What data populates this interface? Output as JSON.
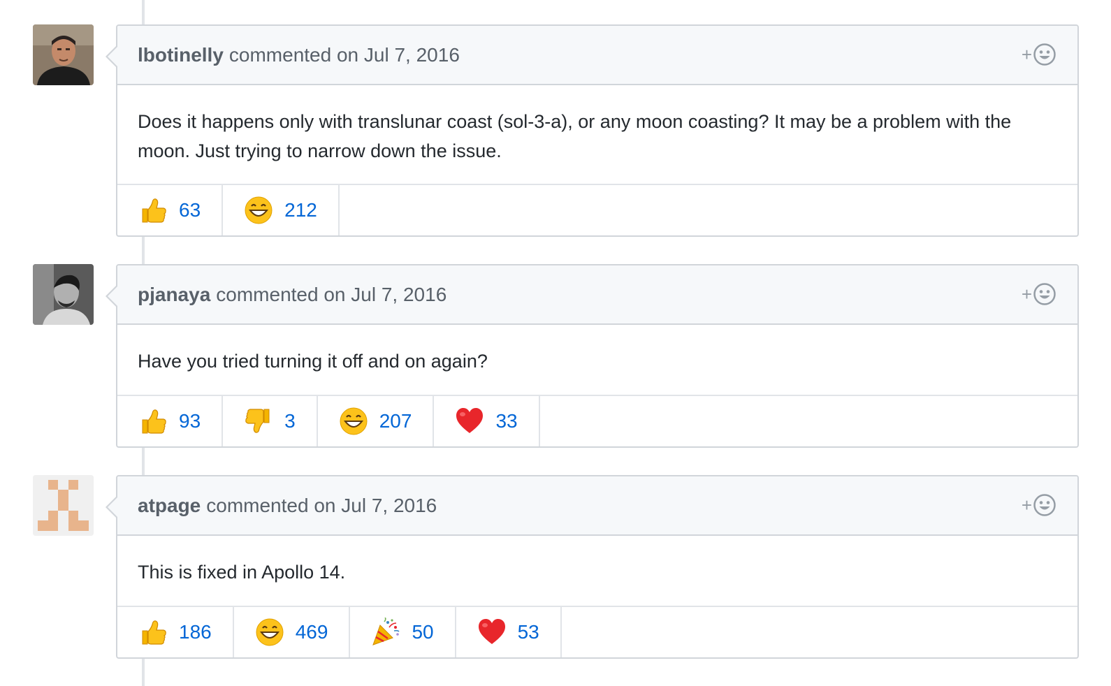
{
  "comments": [
    {
      "author": "lbotinelly",
      "action": "commented on Jul 7, 2016",
      "avatar": "portrait-photo-man",
      "body": "Does it happens only with translunar coast (sol-3-a), or any moon coasting? It may be a problem with the moon. Just trying to narrow down the issue.",
      "reactions": [
        {
          "emoji": "thumbs-up-icon",
          "count": "63"
        },
        {
          "emoji": "smile-icon",
          "count": "212"
        }
      ]
    },
    {
      "author": "pjanaya",
      "action": "commented on Jul 7, 2016",
      "avatar": "bw-photo-man",
      "body": "Have you tried turning it off and on again?",
      "reactions": [
        {
          "emoji": "thumbs-up-icon",
          "count": "93"
        },
        {
          "emoji": "thumbs-down-icon",
          "count": "3"
        },
        {
          "emoji": "smile-icon",
          "count": "207"
        },
        {
          "emoji": "heart-icon",
          "count": "33"
        }
      ]
    },
    {
      "author": "atpage",
      "action": "commented on Jul 7, 2016",
      "avatar": "identicon",
      "body": "This is fixed in Apollo 14.",
      "reactions": [
        {
          "emoji": "thumbs-up-icon",
          "count": "186"
        },
        {
          "emoji": "smile-icon",
          "count": "469"
        },
        {
          "emoji": "tada-icon",
          "count": "50"
        },
        {
          "emoji": "heart-icon",
          "count": "53"
        }
      ]
    }
  ],
  "react_button": {
    "plus": "+",
    "icon": "smiley-icon"
  },
  "colors": {
    "link": "#0366d6",
    "header_bg": "#f6f8fa",
    "border": "#d1d5da",
    "identicon": "#e8b48c"
  }
}
